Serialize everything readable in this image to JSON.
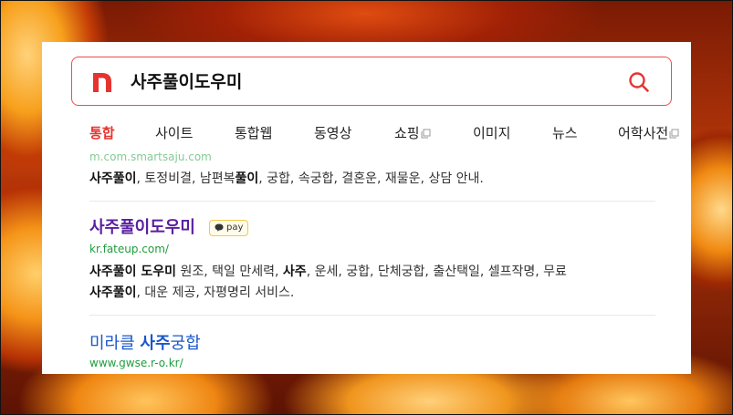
{
  "search": {
    "query": "사주풀이도우미",
    "logo_letter": "n"
  },
  "tabs": [
    {
      "label": "통합",
      "active": true
    },
    {
      "label": "사이트"
    },
    {
      "label": "통합웹"
    },
    {
      "label": "동영상"
    },
    {
      "label": "쇼핑",
      "external": true
    },
    {
      "label": "이미지"
    },
    {
      "label": "뉴스"
    },
    {
      "label": "어학사전",
      "external": true
    }
  ],
  "results": [
    {
      "url_partial": "m.com.smartsaju.com",
      "description": {
        "b1": "사주풀이",
        "t1": ", 토정비결, 남편복",
        "b2": "풀이",
        "t2": ", 궁합, 속궁합, 결혼운, 재물운, 상담 안내."
      }
    },
    {
      "title": "사주풀이도우미",
      "badge": "pay",
      "url": "kr.fateup.com/",
      "description": {
        "line1_b1": "사주풀이 도우미",
        "line1_t1": " 원조, 택일 만세력, ",
        "line1_b2": "사주",
        "line1_t2": ", 운세, 궁합, 단체궁합, 출산택일, 셀프작명, 무료",
        "line2_b1": "사주풀이",
        "line2_t1": ", 대운 제공, 자평명리 서비스."
      }
    },
    {
      "title_prefix": "미라클 ",
      "title_bold": "사주",
      "title_suffix": "궁합",
      "url": "www.gwse.r-o.kr/"
    }
  ],
  "colors": {
    "brand_red": "#e5342f",
    "link_blue": "#1a57c8",
    "visited_purple": "#5a1fa0",
    "url_green": "#1e9e3c"
  },
  "icons": [
    "naver-logo-icon",
    "search-icon",
    "external-window-icon",
    "pay-bubble-icon"
  ]
}
